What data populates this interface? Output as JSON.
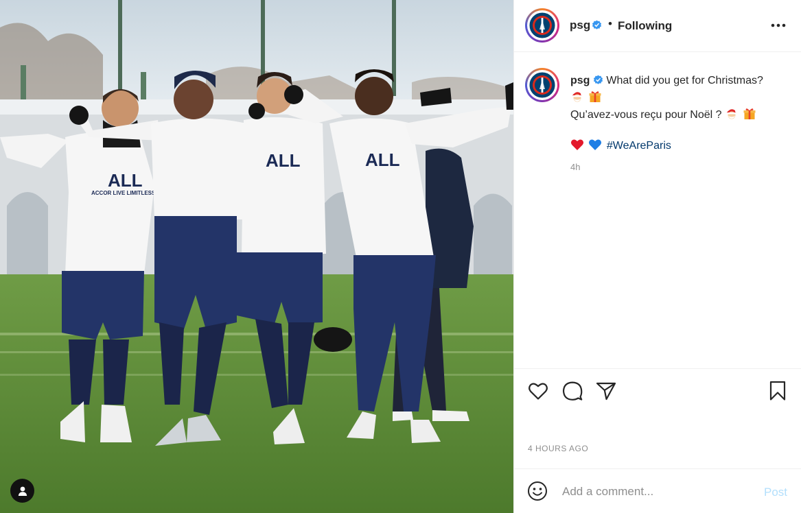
{
  "photo": {
    "alt_subject": "",
    "shirt_sponsor": "ALL",
    "shirt_sponsor_sub": "ACCOR LIVE LIMITLESS",
    "tag_icon": "user-icon"
  },
  "header": {
    "username": "psg",
    "verified_icon": "verified-badge-icon",
    "separator": "•",
    "follow_state": "Following",
    "more_icon": "more-options-icon"
  },
  "caption": {
    "username": "psg",
    "line1": "What did you get for Christmas?",
    "line2": "Qu’avez-vous reçu pour Noël ?",
    "hashtag": "#WeAreParis",
    "relative_time": "4h",
    "emoji_icons": [
      "santa-emoji",
      "gift-emoji",
      "red-heart-emoji",
      "blue-heart-emoji"
    ]
  },
  "actions": {
    "like_icon": "heart-icon",
    "comment_icon": "comment-icon",
    "share_icon": "share-icon",
    "save_icon": "bookmark-icon"
  },
  "timestamp": "4 HOURS AGO",
  "comment": {
    "emoji_icon": "smiley-icon",
    "placeholder": "Add a comment...",
    "post_label": "Post"
  },
  "colors": {
    "text": "#262626",
    "muted": "#8e8e8e",
    "link": "#00376b",
    "post_disabled": "#b2dffc",
    "verified": "#3897f0",
    "psg_navy": "#004170",
    "psg_red": "#da291c"
  }
}
